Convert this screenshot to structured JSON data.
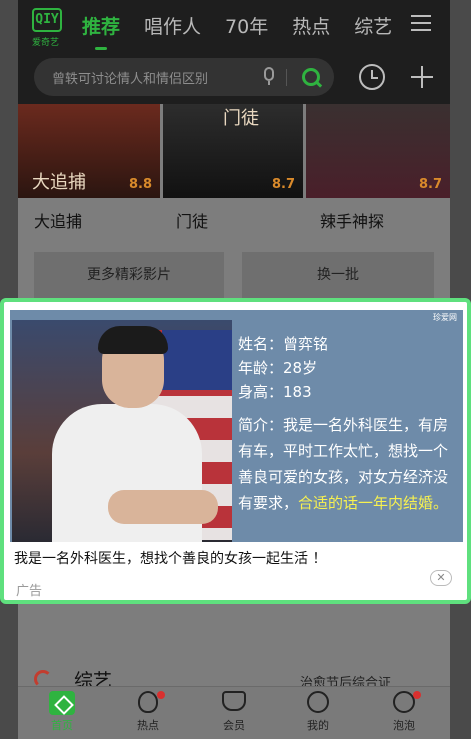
{
  "header": {
    "logo_text": "QIY",
    "logo_sub": "爱奇艺",
    "tabs": [
      "推荐",
      "唱作人",
      "70年",
      "热点",
      "综艺"
    ],
    "active_tab": "推荐"
  },
  "search": {
    "placeholder": "曾轶可讨论情人和情侣区别"
  },
  "movies": [
    {
      "title": "大追捕",
      "score": "8.8",
      "poster_text": "大追捕"
    },
    {
      "title": "门徒",
      "score": "8.7",
      "poster_text": "门徒"
    },
    {
      "title": "辣手神探",
      "score": "8.7",
      "poster_text": ""
    }
  ],
  "actions": {
    "more_label": "更多精彩影片",
    "swap_label": "换一批"
  },
  "ad": {
    "source": "珍爱网",
    "name": "姓名：曾弈铭",
    "age": "年龄：28岁",
    "height": "身高：183",
    "intro_white": "简介：我是一名外科医生，有房有车，平时工作太忙，想找一个善良可爱的女孩，对女方经济没有要求，",
    "intro_yellow": "合适的话一年内结婚。",
    "caption": "我是一名外科医生，想找个善良的女孩一起生活 ！",
    "label": "广告",
    "close": "✕"
  },
  "section": {
    "title": "综艺",
    "subtitle": "治愈节后综合证"
  },
  "bottom_nav": [
    {
      "label": "首页",
      "active": true
    },
    {
      "label": "热点",
      "badge": true
    },
    {
      "label": "会员"
    },
    {
      "label": "我的"
    },
    {
      "label": "泡泡",
      "badge": true
    }
  ],
  "colors": {
    "accent": "#2fb340",
    "ad_border": "#5fe07e",
    "highlight": "#f7f150"
  }
}
